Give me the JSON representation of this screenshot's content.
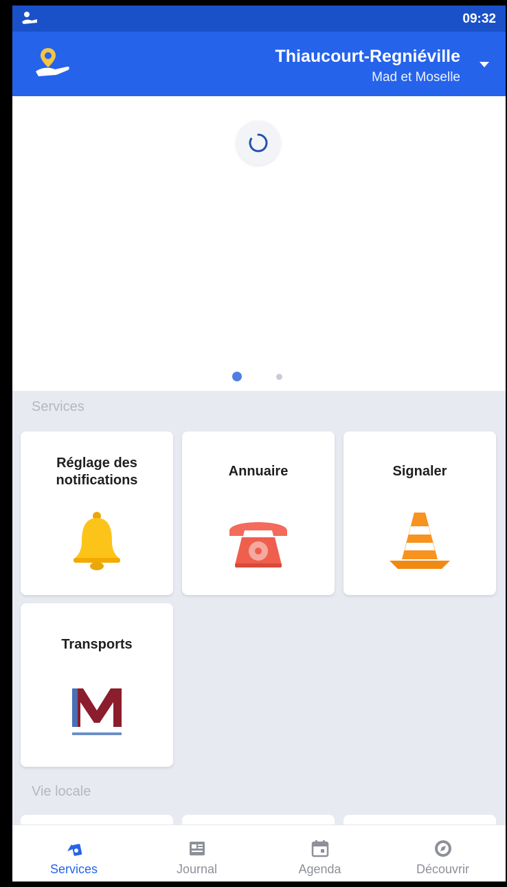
{
  "status_bar": {
    "time": "09:32",
    "icon": "app-notification-icon"
  },
  "header": {
    "city": "Thiaucourt-Regniéville",
    "community": "Mad et Moselle",
    "logo_icon": "map-pin-hand-icon",
    "dropdown_icon": "caret-down-icon"
  },
  "carousel": {
    "loading": true,
    "pages": 2,
    "active_page": 1
  },
  "services": {
    "title": "Services",
    "tiles": [
      {
        "label": "Réglage des notifications",
        "icon": "bell-icon"
      },
      {
        "label": "Annuaire",
        "icon": "telephone-icon"
      },
      {
        "label": "Signaler",
        "icon": "traffic-cone-icon"
      },
      {
        "label": "Transports",
        "icon": "transport-m-logo"
      }
    ]
  },
  "vie_locale": {
    "title": "Vie locale"
  },
  "bottom_nav": {
    "items": [
      {
        "label": "Services",
        "icon": "services-icon",
        "active": true
      },
      {
        "label": "Journal",
        "icon": "newspaper-icon",
        "active": false
      },
      {
        "label": "Agenda",
        "icon": "calendar-icon",
        "active": false
      },
      {
        "label": "Découvrir",
        "icon": "compass-icon",
        "active": false
      }
    ]
  },
  "colors": {
    "primary": "#2563eb",
    "status_bar": "#1a51c8",
    "background": "#e8eaf2"
  }
}
